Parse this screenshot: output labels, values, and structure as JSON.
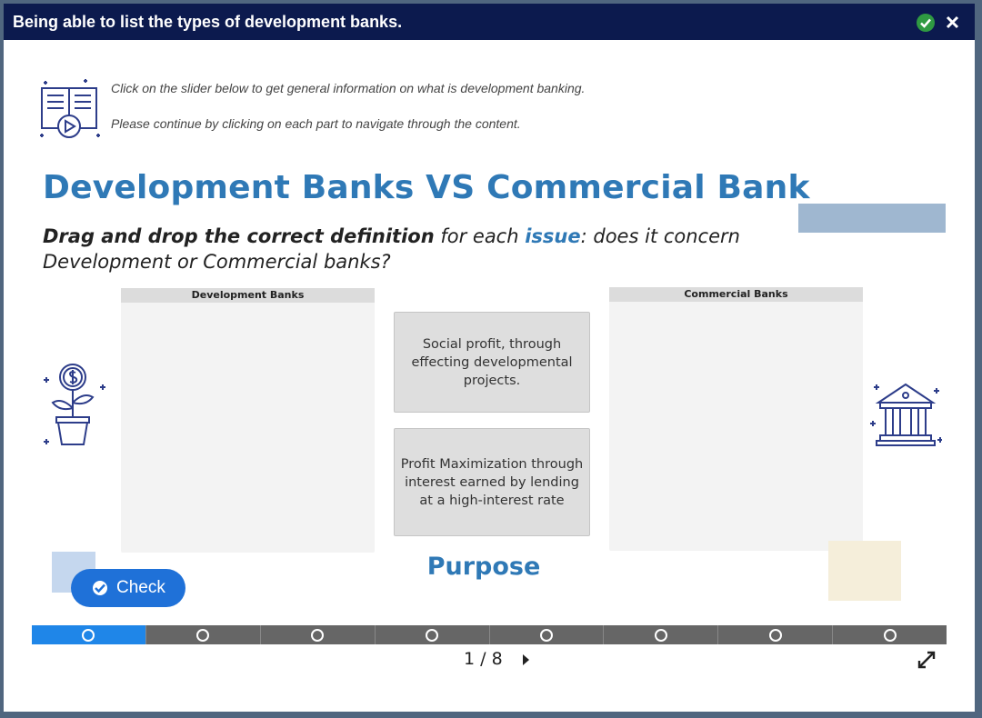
{
  "window": {
    "title": "Being able to list the types of development banks."
  },
  "intro": {
    "line1": "Click on the slider below to get general information on what is development banking.",
    "line2": "Please continue by clicking on each part to navigate through the content."
  },
  "main": {
    "heading": "Development Banks VS Commercial Bank",
    "instruction": {
      "bold_part": "Drag and drop the correct definition",
      "part2": " for each ",
      "accent": "issue",
      "part3": ": does it concern Development or Commercial banks?"
    },
    "zones": {
      "development_label": "Development Banks",
      "commercial_label": "Commercial Banks"
    },
    "draggables": [
      {
        "text": "Social profit, through effecting developmental projects."
      },
      {
        "text": "Profit Maximization through interest earned by lending at a high-interest rate"
      }
    ],
    "category": "Purpose",
    "check_label": "Check"
  },
  "slider": {
    "segments": 8,
    "active_index": 0
  },
  "pager": {
    "text": "1 / 8"
  },
  "colors": {
    "titlebar": "#0c1a4e",
    "accent": "#2f79b6",
    "button": "#1f71d8",
    "slider_active": "#1f86e8",
    "slider_inactive": "#666666"
  },
  "icons": [
    "check-circle-icon",
    "close-icon",
    "book-video-icon",
    "money-plant-icon",
    "bank-building-icon",
    "expand-icon",
    "chevron-right-icon"
  ]
}
